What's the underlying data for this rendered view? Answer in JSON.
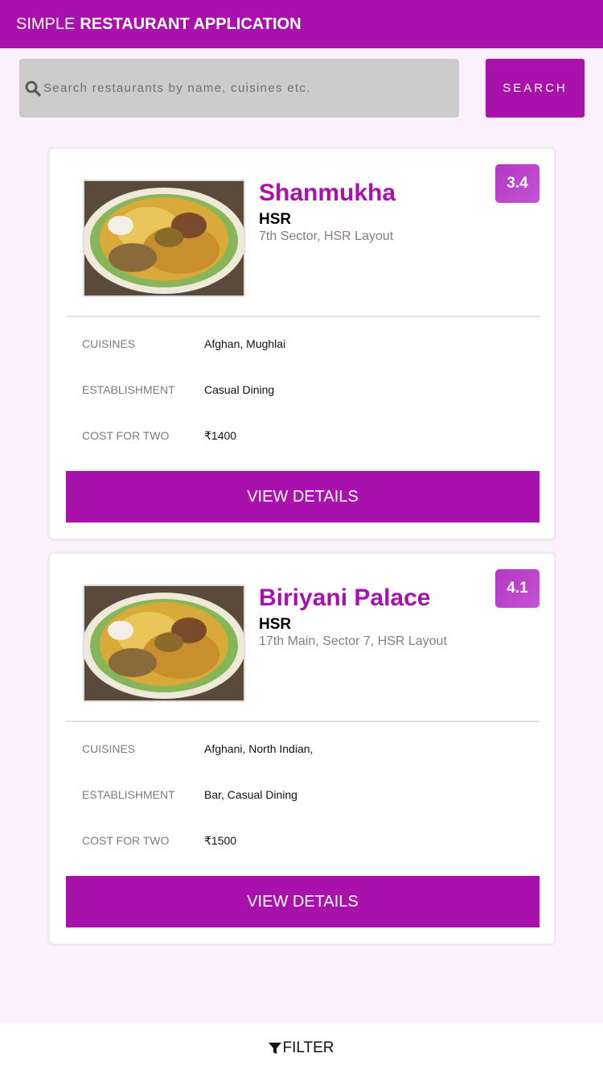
{
  "header": {
    "title_light": "SIMPLE",
    "title_bold": "RESTAURANT APPLICATION"
  },
  "search": {
    "placeholder": "Search restaurants by name, cuisines etc.",
    "button_label": "SEARCH",
    "icon": "search-icon"
  },
  "restaurants": [
    {
      "name": "Shanmukha",
      "locality": "HSR",
      "address": "7th Sector, HSR Layout",
      "rating": "3.4",
      "rows": [
        {
          "label": "CUISINES",
          "value": "Afghan, Mughlai"
        },
        {
          "label": "ESTABLISHMENT",
          "value": "Casual Dining"
        },
        {
          "label": "COST FOR TWO",
          "value": "₹1400"
        }
      ],
      "button_label": "VIEW DETAILS"
    },
    {
      "name": "Biriyani Palace",
      "locality": "HSR",
      "address": "17th Main, Sector 7, HSR Layout",
      "rating": "4.1",
      "rows": [
        {
          "label": "CUISINES",
          "value": "Afghani, North Indian,"
        },
        {
          "label": "ESTABLISHMENT",
          "value": "Bar, Casual Dining"
        },
        {
          "label": "COST FOR TWO",
          "value": "₹1500"
        }
      ],
      "button_label": "VIEW DETAILS"
    }
  ],
  "footer": {
    "filter_label": "FILTER",
    "icon": "filter-icon"
  },
  "colors": {
    "brand": "#a911ad",
    "background": "#fdf0fd",
    "rating_badge": "#b436c4"
  }
}
